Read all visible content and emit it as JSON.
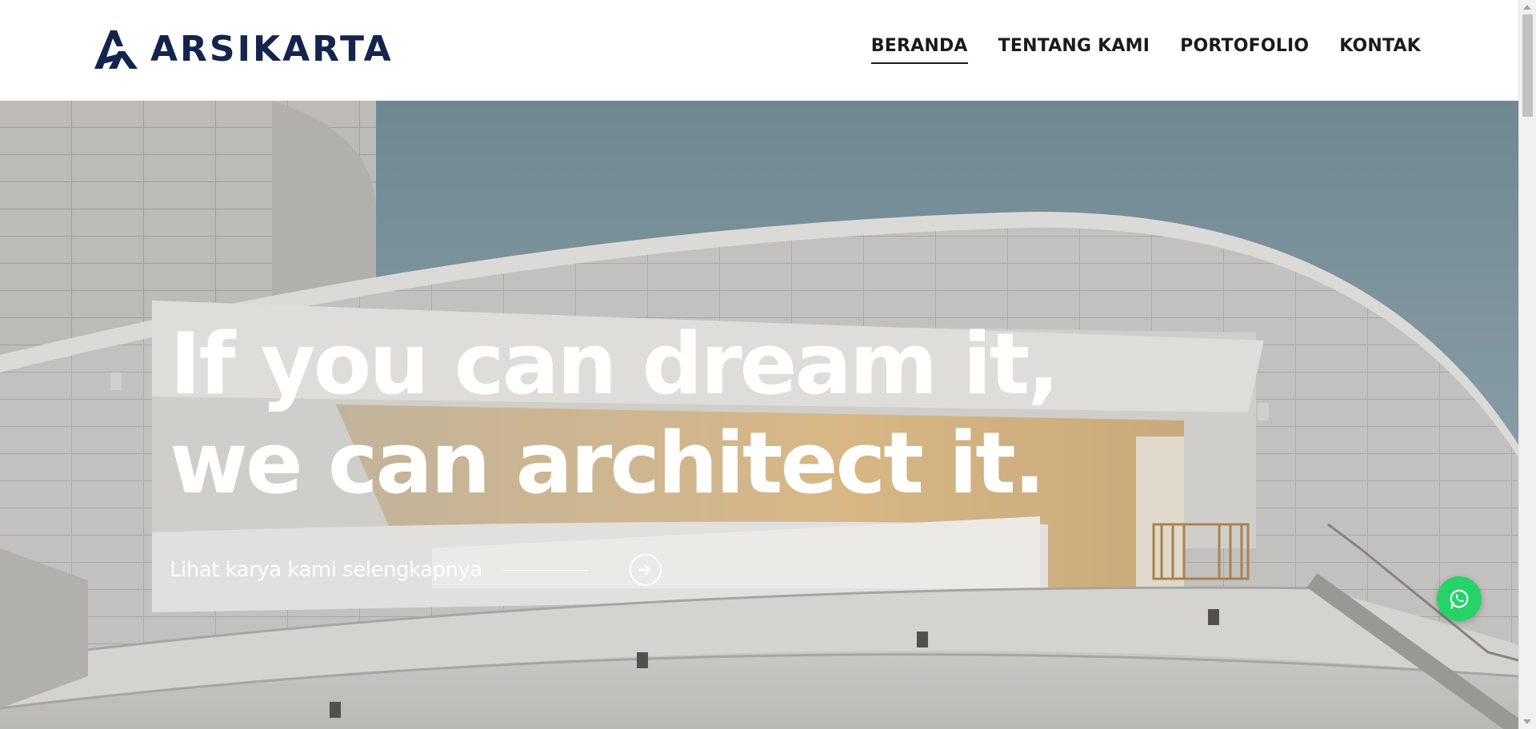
{
  "brand": {
    "name": "ARSIKARTA",
    "color": "#14244c"
  },
  "nav": {
    "items": [
      {
        "label": "BERANDA",
        "active": true
      },
      {
        "label": "TENTANG KAMI",
        "active": false
      },
      {
        "label": "PORTOFOLIO",
        "active": false
      },
      {
        "label": "KONTAK",
        "active": false
      }
    ]
  },
  "hero": {
    "headline_line1": "If you can dream it,",
    "headline_line2": "we can architect it.",
    "cta_label": "Lihat karya kami selengkapnya",
    "cta_icon": "arrow-right-circle-icon"
  },
  "floating": {
    "icon": "whatsapp-icon",
    "color": "#25d366"
  },
  "colors": {
    "nav_text": "#1b1b1b",
    "hero_text": "#ffffff"
  }
}
